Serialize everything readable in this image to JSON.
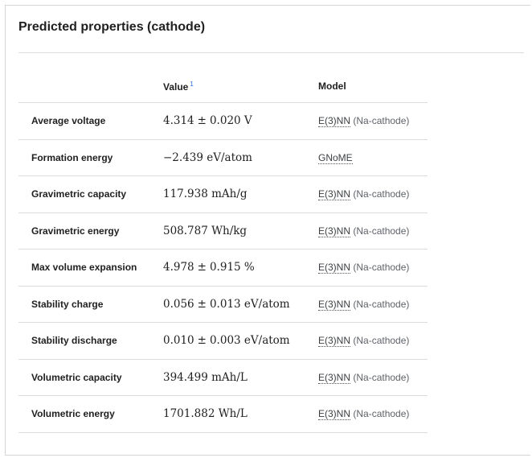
{
  "card": {
    "title": "Predicted properties (cathode)"
  },
  "table": {
    "headers": {
      "property": "",
      "value": "Value",
      "value_footnote": "1",
      "model": "Model"
    },
    "rows": [
      {
        "property": "Average voltage",
        "value": "4.314",
        "uncertainty": "0.020",
        "unit": "V",
        "model": "E(3)NN",
        "model_detail": "(Na-cathode)"
      },
      {
        "property": "Formation energy",
        "value": "−2.439",
        "uncertainty": null,
        "unit": "eV/atom",
        "model": "GNoME",
        "model_detail": null
      },
      {
        "property": "Gravimetric capacity",
        "value": "117.938",
        "uncertainty": null,
        "unit": "mAh/g",
        "model": "E(3)NN",
        "model_detail": "(Na-cathode)"
      },
      {
        "property": "Gravimetric energy",
        "value": "508.787",
        "uncertainty": null,
        "unit": "Wh/kg",
        "model": "E(3)NN",
        "model_detail": "(Na-cathode)"
      },
      {
        "property": "Max volume expansion",
        "value": "4.978",
        "uncertainty": "0.915",
        "unit": "%",
        "model": "E(3)NN",
        "model_detail": "(Na-cathode)"
      },
      {
        "property": "Stability charge",
        "value": "0.056",
        "uncertainty": "0.013",
        "unit": "eV/atom",
        "model": "E(3)NN",
        "model_detail": "(Na-cathode)"
      },
      {
        "property": "Stability discharge",
        "value": "0.010",
        "uncertainty": "0.003",
        "unit": "eV/atom",
        "model": "E(3)NN",
        "model_detail": "(Na-cathode)"
      },
      {
        "property": "Volumetric capacity",
        "value": "394.499",
        "uncertainty": null,
        "unit": "mAh/L",
        "model": "E(3)NN",
        "model_detail": "(Na-cathode)"
      },
      {
        "property": "Volumetric energy",
        "value": "1701.882",
        "uncertainty": null,
        "unit": "Wh/L",
        "model": "E(3)NN",
        "model_detail": "(Na-cathode)"
      }
    ]
  }
}
